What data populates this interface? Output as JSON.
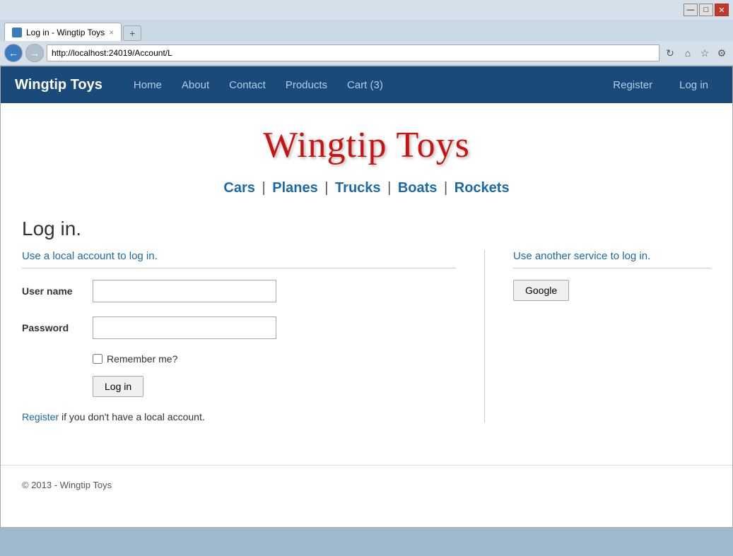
{
  "browser": {
    "address": "http://localhost:24019/Account/L",
    "tab_title": "Log in - Wingtip Toys",
    "tab_close": "×",
    "tab_new": "+",
    "titlebar": {
      "minimize": "—",
      "maximize": "□",
      "close": "✕"
    }
  },
  "navbar": {
    "brand": "Wingtip Toys",
    "links": [
      {
        "label": "Home"
      },
      {
        "label": "About"
      },
      {
        "label": "Contact"
      },
      {
        "label": "Products"
      },
      {
        "label": "Cart (3)"
      }
    ],
    "right_links": [
      {
        "label": "Register"
      },
      {
        "label": "Log in"
      }
    ]
  },
  "hero": {
    "title": "Wingtip Toys"
  },
  "categories": [
    {
      "label": "Cars"
    },
    {
      "label": "Planes"
    },
    {
      "label": "Trucks"
    },
    {
      "label": "Boats"
    },
    {
      "label": "Rockets"
    }
  ],
  "login": {
    "page_title": "Log in.",
    "local_subtitle": "Use a local account to log in.",
    "service_subtitle": "Use another service to log in.",
    "username_label": "User name",
    "password_label": "Password",
    "remember_label": "Remember me?",
    "login_button": "Log in",
    "google_button": "Google",
    "register_text": " if you don't have a local account.",
    "register_link": "Register"
  },
  "footer": {
    "text": "© 2013 - Wingtip Toys"
  }
}
